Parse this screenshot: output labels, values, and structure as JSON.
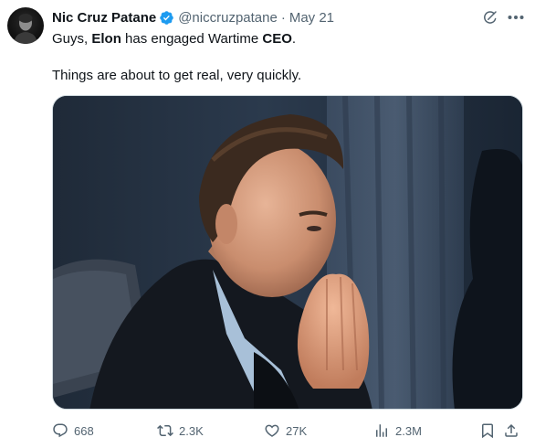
{
  "author": {
    "display_name": "Nic Cruz Patane",
    "handle": "@niccruzpatane",
    "separator": "·",
    "date": "May 21",
    "verified": true
  },
  "tweet": {
    "line1_pre": "Guys, ",
    "line1_bold1": "Elon",
    "line1_mid": " has engaged Wartime ",
    "line1_bold2": "CEO",
    "line1_post": ".",
    "line2": "Things are about to get real, very quickly."
  },
  "actions": {
    "replies": "668",
    "retweets": "2.3K",
    "likes": "27K",
    "views": "2.3M"
  },
  "icons": [
    "grok-icon",
    "more-icon",
    "verified-badge-icon",
    "reply-icon",
    "retweet-icon",
    "like-icon",
    "views-icon",
    "bookmark-icon",
    "share-icon"
  ],
  "colors": {
    "text_primary": "#0f1419",
    "text_secondary": "#536471",
    "verified_blue": "#1d9bf0"
  }
}
